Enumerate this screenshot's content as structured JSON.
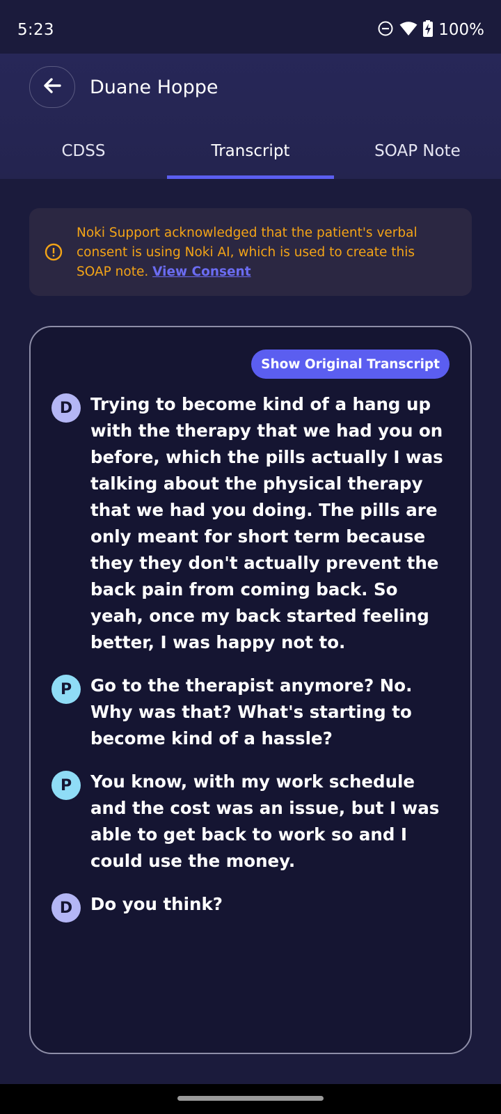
{
  "status_bar": {
    "time": "5:23",
    "battery": "100%",
    "icons": [
      "do-not-disturb-icon",
      "wifi-icon",
      "battery-charging-icon"
    ]
  },
  "header": {
    "title": "Duane Hoppe",
    "back_icon": "arrow-left-icon"
  },
  "tabs": [
    {
      "label": "CDSS",
      "active": false
    },
    {
      "label": "Transcript",
      "active": true
    },
    {
      "label": "SOAP Note",
      "active": false
    }
  ],
  "consent_banner": {
    "icon": "info-icon",
    "text": "Noki Support acknowledged that the patient's verbal consent is using Noki AI, which is used to create this SOAP note.",
    "link": "View Consent"
  },
  "transcript": {
    "toggle_label": "Show Original Transcript",
    "messages": [
      {
        "speaker": "D",
        "text": "Trying to become kind of a hang up with the therapy that we had you on before, which the pills actually I was talking about the physical therapy that we had you doing. The pills are only meant for short term because they they don't actually prevent the back pain from coming back. So yeah, once my back started feeling better, I was happy not to."
      },
      {
        "speaker": "P",
        "text": "Go to the therapist anymore? No. Why was that? What's starting to become kind of a hassle?"
      },
      {
        "speaker": "P",
        "text": "You know, with my work schedule and the cost was an issue, but I was able to get back to work so and I could use the money."
      },
      {
        "speaker": "D",
        "text": "Do you think?"
      }
    ]
  },
  "colors": {
    "background": "#1b1b3c",
    "app_bar": "#272758",
    "accent": "#5b5ef0",
    "warning_text": "#f3a417",
    "doctor_avatar": "#b4b6f5",
    "patient_avatar": "#8fdcf6"
  }
}
